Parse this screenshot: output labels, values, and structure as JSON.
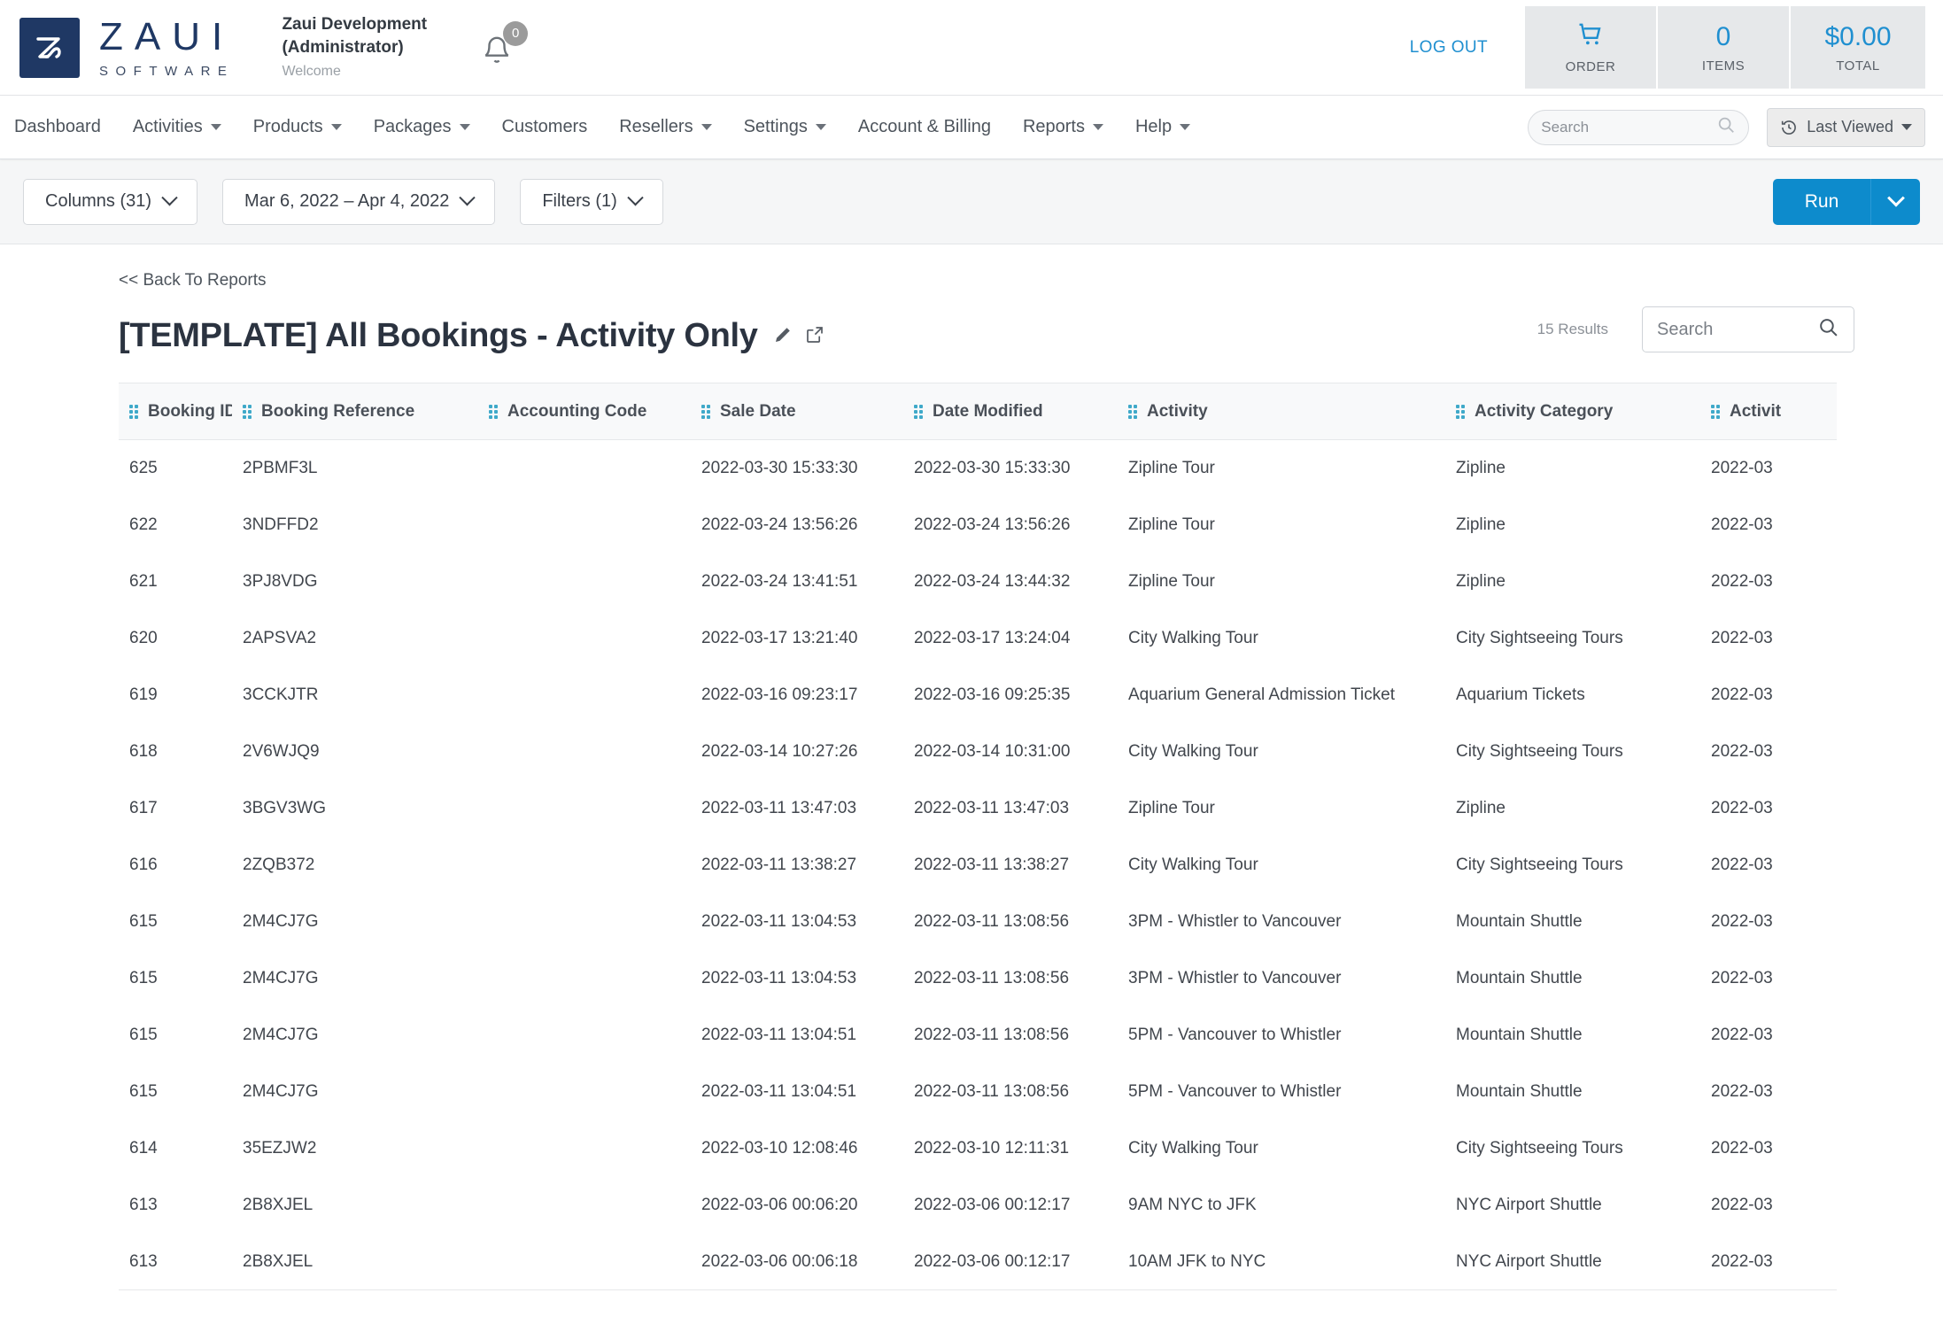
{
  "topbar": {
    "logo_word": "ZAUI",
    "logo_sub": "SOFTWARE",
    "account_name": "Zaui Development",
    "account_role": "(Administrator)",
    "welcome": "Welcome",
    "notifications_count": "0",
    "logout_label": "LOG OUT",
    "order": {
      "icon": "cart-icon",
      "label": "ORDER"
    },
    "items": {
      "value": "0",
      "label": "ITEMS"
    },
    "total": {
      "value": "$0.00",
      "label": "TOTAL"
    },
    "accent_blue": "#1f8fd0",
    "brand_navy": "#1f3864"
  },
  "nav": {
    "items": [
      {
        "label": "Dashboard",
        "has_caret": false
      },
      {
        "label": "Activities",
        "has_caret": true
      },
      {
        "label": "Products",
        "has_caret": true
      },
      {
        "label": "Packages",
        "has_caret": true
      },
      {
        "label": "Customers",
        "has_caret": false
      },
      {
        "label": "Resellers",
        "has_caret": true
      },
      {
        "label": "Settings",
        "has_caret": true
      },
      {
        "label": "Account & Billing",
        "has_caret": false
      },
      {
        "label": "Reports",
        "has_caret": true
      },
      {
        "label": "Help",
        "has_caret": true
      }
    ],
    "search_placeholder": "Search",
    "search_value": "",
    "last_viewed_label": "Last Viewed"
  },
  "filterbar": {
    "columns_label": "Columns (31)",
    "date_range_label": "Mar 6, 2022 – Apr 4, 2022",
    "filters_label": "Filters (1)",
    "run_label": "Run",
    "run_accent": "#0d8bcc"
  },
  "report": {
    "back_link": "<< Back To Reports",
    "title": "[TEMPLATE] All Bookings - Activity Only",
    "results_count": "15 Results",
    "search_placeholder": "Search",
    "search_value": "",
    "columns": [
      "Booking ID",
      "Booking Reference",
      "Accounting Code",
      "Sale Date",
      "Date Modified",
      "Activity",
      "Activity Category",
      "Activit"
    ],
    "rows": [
      {
        "booking_id": "625",
        "booking_reference": "2PBMF3L",
        "accounting_code": "",
        "sale_date": "2022-03-30 15:33:30",
        "date_modified": "2022-03-30 15:33:30",
        "activity": "Zipline Tour",
        "activity_category": "Zipline",
        "activity_date": "2022-03"
      },
      {
        "booking_id": "622",
        "booking_reference": "3NDFFD2",
        "accounting_code": "",
        "sale_date": "2022-03-24 13:56:26",
        "date_modified": "2022-03-24 13:56:26",
        "activity": "Zipline Tour",
        "activity_category": "Zipline",
        "activity_date": "2022-03"
      },
      {
        "booking_id": "621",
        "booking_reference": "3PJ8VDG",
        "accounting_code": "",
        "sale_date": "2022-03-24 13:41:51",
        "date_modified": "2022-03-24 13:44:32",
        "activity": "Zipline Tour",
        "activity_category": "Zipline",
        "activity_date": "2022-03"
      },
      {
        "booking_id": "620",
        "booking_reference": "2APSVA2",
        "accounting_code": "",
        "sale_date": "2022-03-17 13:21:40",
        "date_modified": "2022-03-17 13:24:04",
        "activity": "City Walking Tour",
        "activity_category": "City Sightseeing Tours",
        "activity_date": "2022-03"
      },
      {
        "booking_id": "619",
        "booking_reference": "3CCKJTR",
        "accounting_code": "",
        "sale_date": "2022-03-16 09:23:17",
        "date_modified": "2022-03-16 09:25:35",
        "activity": "Aquarium General Admission Ticket",
        "activity_category": "Aquarium Tickets",
        "activity_date": "2022-03"
      },
      {
        "booking_id": "618",
        "booking_reference": "2V6WJQ9",
        "accounting_code": "",
        "sale_date": "2022-03-14 10:27:26",
        "date_modified": "2022-03-14 10:31:00",
        "activity": "City Walking Tour",
        "activity_category": "City Sightseeing Tours",
        "activity_date": "2022-03"
      },
      {
        "booking_id": "617",
        "booking_reference": "3BGV3WG",
        "accounting_code": "",
        "sale_date": "2022-03-11 13:47:03",
        "date_modified": "2022-03-11 13:47:03",
        "activity": "Zipline Tour",
        "activity_category": "Zipline",
        "activity_date": "2022-03"
      },
      {
        "booking_id": "616",
        "booking_reference": "2ZQB372",
        "accounting_code": "",
        "sale_date": "2022-03-11 13:38:27",
        "date_modified": "2022-03-11 13:38:27",
        "activity": "City Walking Tour",
        "activity_category": "City Sightseeing Tours",
        "activity_date": "2022-03"
      },
      {
        "booking_id": "615",
        "booking_reference": "2M4CJ7G",
        "accounting_code": "",
        "sale_date": "2022-03-11 13:04:53",
        "date_modified": "2022-03-11 13:08:56",
        "activity": "3PM - Whistler to Vancouver",
        "activity_category": "Mountain Shuttle",
        "activity_date": "2022-03"
      },
      {
        "booking_id": "615",
        "booking_reference": "2M4CJ7G",
        "accounting_code": "",
        "sale_date": "2022-03-11 13:04:53",
        "date_modified": "2022-03-11 13:08:56",
        "activity": "3PM - Whistler to Vancouver",
        "activity_category": "Mountain Shuttle",
        "activity_date": "2022-03"
      },
      {
        "booking_id": "615",
        "booking_reference": "2M4CJ7G",
        "accounting_code": "",
        "sale_date": "2022-03-11 13:04:51",
        "date_modified": "2022-03-11 13:08:56",
        "activity": "5PM - Vancouver to Whistler",
        "activity_category": "Mountain Shuttle",
        "activity_date": "2022-03"
      },
      {
        "booking_id": "615",
        "booking_reference": "2M4CJ7G",
        "accounting_code": "",
        "sale_date": "2022-03-11 13:04:51",
        "date_modified": "2022-03-11 13:08:56",
        "activity": "5PM - Vancouver to Whistler",
        "activity_category": "Mountain Shuttle",
        "activity_date": "2022-03"
      },
      {
        "booking_id": "614",
        "booking_reference": "35EZJW2",
        "accounting_code": "",
        "sale_date": "2022-03-10 12:08:46",
        "date_modified": "2022-03-10 12:11:31",
        "activity": "City Walking Tour",
        "activity_category": "City Sightseeing Tours",
        "activity_date": "2022-03"
      },
      {
        "booking_id": "613",
        "booking_reference": "2B8XJEL",
        "accounting_code": "",
        "sale_date": "2022-03-06 00:06:20",
        "date_modified": "2022-03-06 00:12:17",
        "activity": "9AM NYC to JFK",
        "activity_category": "NYC Airport Shuttle",
        "activity_date": "2022-03"
      },
      {
        "booking_id": "613",
        "booking_reference": "2B8XJEL",
        "accounting_code": "",
        "sale_date": "2022-03-06 00:06:18",
        "date_modified": "2022-03-06 00:12:17",
        "activity": "10AM JFK to NYC",
        "activity_category": "NYC Airport Shuttle",
        "activity_date": "2022-03"
      }
    ]
  }
}
